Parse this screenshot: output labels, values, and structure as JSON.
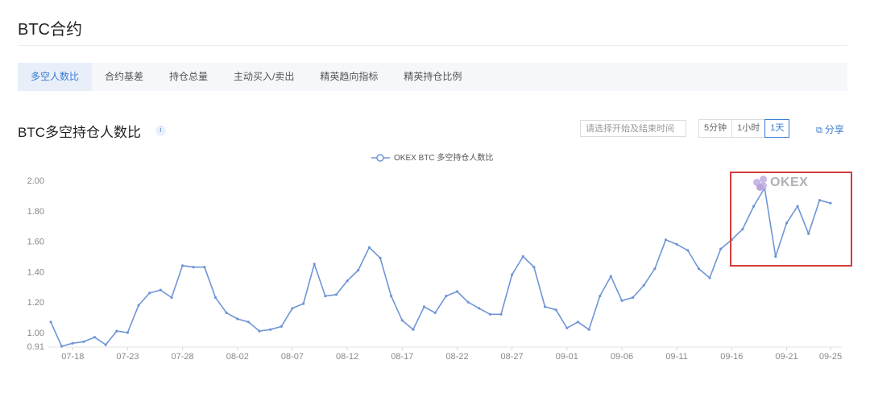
{
  "page": {
    "title": "BTC合约"
  },
  "tabs": [
    {
      "label": "多空人数比",
      "active": true
    },
    {
      "label": "合约基差",
      "active": false
    },
    {
      "label": "持仓总量",
      "active": false
    },
    {
      "label": "主动买入/卖出",
      "active": false
    },
    {
      "label": "精英趋向指标",
      "active": false
    },
    {
      "label": "精英持仓比例",
      "active": false
    }
  ],
  "section": {
    "title": "BTC多空持仓人数比",
    "info_icon": "info-icon"
  },
  "controls": {
    "date_placeholder": "请选择开始及结束时间",
    "intervals": [
      {
        "label": "5分钟",
        "active": false
      },
      {
        "label": "1小时",
        "active": false
      },
      {
        "label": "1天",
        "active": true
      }
    ],
    "share_label": "分享",
    "share_icon": "external-link-icon"
  },
  "watermark": {
    "text": "OKEX"
  },
  "colors": {
    "accent": "#3a7bd5",
    "line": "#6f95d6",
    "highlight": "#d23c3c"
  },
  "chart_data": {
    "type": "line",
    "legend": "top-center",
    "grid": false,
    "series": [
      {
        "name": "OKEX BTC 多空持仓人数比",
        "x": [
          "07-16",
          "07-17",
          "07-18",
          "07-19",
          "07-20",
          "07-21",
          "07-22",
          "07-23",
          "07-24",
          "07-25",
          "07-26",
          "07-27",
          "07-28",
          "07-29",
          "07-30",
          "07-31",
          "08-01",
          "08-02",
          "08-03",
          "08-04",
          "08-05",
          "08-06",
          "08-07",
          "08-08",
          "08-09",
          "08-10",
          "08-11",
          "08-12",
          "08-13",
          "08-14",
          "08-15",
          "08-16",
          "08-17",
          "08-18",
          "08-19",
          "08-20",
          "08-21",
          "08-22",
          "08-23",
          "08-24",
          "08-25",
          "08-26",
          "08-27",
          "08-28",
          "08-29",
          "08-30",
          "08-31",
          "09-01",
          "09-02",
          "09-03",
          "09-04",
          "09-05",
          "09-06",
          "09-07",
          "09-08",
          "09-09",
          "09-10",
          "09-11",
          "09-12",
          "09-13",
          "09-14",
          "09-15",
          "09-16",
          "09-17",
          "09-18",
          "09-19",
          "09-20",
          "09-21",
          "09-22",
          "09-23",
          "09-24",
          "09-25"
        ],
        "values": [
          1.07,
          0.91,
          0.93,
          0.94,
          0.97,
          0.92,
          1.01,
          1.0,
          1.18,
          1.26,
          1.28,
          1.23,
          1.44,
          1.43,
          1.43,
          1.23,
          1.13,
          1.09,
          1.07,
          1.01,
          1.02,
          1.04,
          1.16,
          1.19,
          1.45,
          1.24,
          1.25,
          1.34,
          1.41,
          1.56,
          1.49,
          1.24,
          1.08,
          1.02,
          1.17,
          1.13,
          1.24,
          1.27,
          1.2,
          1.16,
          1.12,
          1.12,
          1.38,
          1.5,
          1.43,
          1.17,
          1.15,
          1.03,
          1.07,
          1.02,
          1.24,
          1.37,
          1.21,
          1.23,
          1.31,
          1.42,
          1.61,
          1.58,
          1.54,
          1.42,
          1.36,
          1.55,
          1.61,
          1.68,
          1.83,
          1.95,
          1.5,
          1.72,
          1.83,
          1.65,
          1.87,
          1.85
        ]
      }
    ],
    "x_tick_labels": [
      "07-18",
      "07-23",
      "07-28",
      "08-02",
      "08-07",
      "08-12",
      "08-17",
      "08-22",
      "08-27",
      "09-01",
      "09-06",
      "09-11",
      "09-16",
      "09-21",
      "09-25"
    ],
    "y_tick_labels": [
      "2.00",
      "1.80",
      "1.60",
      "1.40",
      "1.20",
      "1.00",
      "0.91"
    ],
    "y_ticks": [
      2.0,
      1.8,
      1.6,
      1.4,
      1.2,
      1.0,
      0.91
    ],
    "ylim": [
      0.91,
      2.0
    ],
    "annotations": [
      {
        "type": "highlight-box",
        "from": "09-16",
        "to": "09-25"
      }
    ]
  }
}
